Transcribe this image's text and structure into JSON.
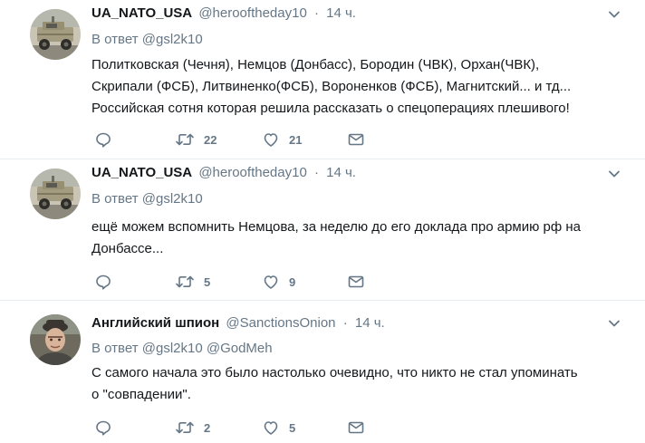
{
  "tweets": [
    {
      "fullname": "UA_NATO_USA",
      "username": "@herooftheday10",
      "separator": "·",
      "time": "14 ч.",
      "reply_prefix": "В ответ",
      "reply_mentions": "@gsl2k10",
      "text_lines": [
        "Политковская (Чечня), Немцов (Донбасс), Бородин (ЧВК), Орхан(ЧВК),",
        "Скрипали (ФСБ), Литвиненко(ФСБ), Вороненков (ФСБ), Магнитский... и тд...",
        "Российская сотня которая решила рассказать о спецоперациях плешивого!"
      ],
      "retweets": "22",
      "likes": "21",
      "avatar_icon": "humvee-avatar"
    },
    {
      "fullname": "UA_NATO_USA",
      "username": "@herooftheday10",
      "separator": "·",
      "time": "14 ч.",
      "reply_prefix": "В ответ",
      "reply_mentions": "@gsl2k10",
      "text_lines": [
        "ещё можем вспомнить Немцова, за неделю до его доклада про армию рф на",
        "Донбассе..."
      ],
      "retweets": "5",
      "likes": "9",
      "avatar_icon": "humvee-avatar"
    },
    {
      "fullname": "Английский шпион",
      "username": "@SanctionsOnion",
      "separator": "·",
      "time": "14 ч.",
      "reply_prefix": "В ответ",
      "reply_mentions": "@gsl2k10 @GodMeh",
      "text_lines": [
        "С самого начала это было настолько очевидно, что никто не стал упоминать",
        "о \"совпадении\"."
      ],
      "retweets": "2",
      "likes": "5",
      "avatar_icon": "man-in-hat-avatar"
    }
  ],
  "colors": {
    "secondary_text": "#657786",
    "primary_text": "#14171a",
    "divider": "#e6ecf0"
  },
  "icons": [
    "reply-icon",
    "retweet-icon",
    "like-icon",
    "direct-message-icon",
    "caret-down-icon"
  ]
}
